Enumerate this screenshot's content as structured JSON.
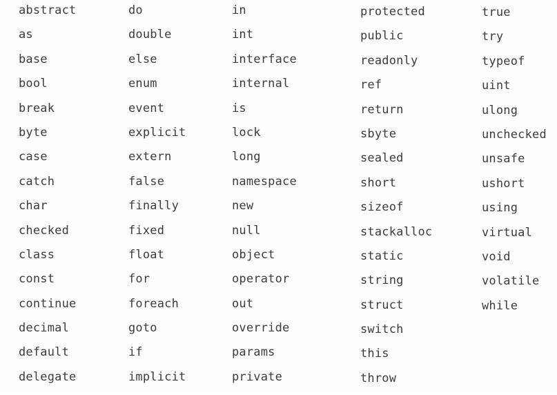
{
  "keywords": {
    "col1": [
      "abstract",
      "as",
      "base",
      "bool",
      "break",
      "byte",
      "case",
      "catch",
      "char",
      "checked",
      "class",
      "const",
      "continue",
      "decimal",
      "default",
      "delegate"
    ],
    "col2": [
      "do",
      "double",
      "else",
      "enum",
      "event",
      "explicit",
      "extern",
      "false",
      "finally",
      "fixed",
      "float",
      "for",
      "foreach",
      "goto",
      "if",
      "implicit"
    ],
    "col3": [
      "in",
      "int",
      "interface",
      "internal",
      "is",
      "lock",
      "long",
      "namespace",
      "new",
      "null",
      "object",
      "operator",
      "out",
      "override",
      "params",
      "private"
    ],
    "col4": [
      "protected",
      "public",
      "readonly",
      "ref",
      "return",
      "sbyte",
      "sealed",
      "short",
      "sizeof",
      "stackalloc",
      "static",
      "string",
      "struct",
      "switch",
      "this",
      "throw"
    ],
    "col5": [
      "true",
      "try",
      "typeof",
      "uint",
      "ulong",
      "unchecked",
      "unsafe",
      "ushort",
      "using",
      "virtual",
      "void",
      "volatile",
      "while"
    ]
  },
  "colors": {
    "text": "#3c3c3c",
    "background": "#fdfdfd"
  }
}
